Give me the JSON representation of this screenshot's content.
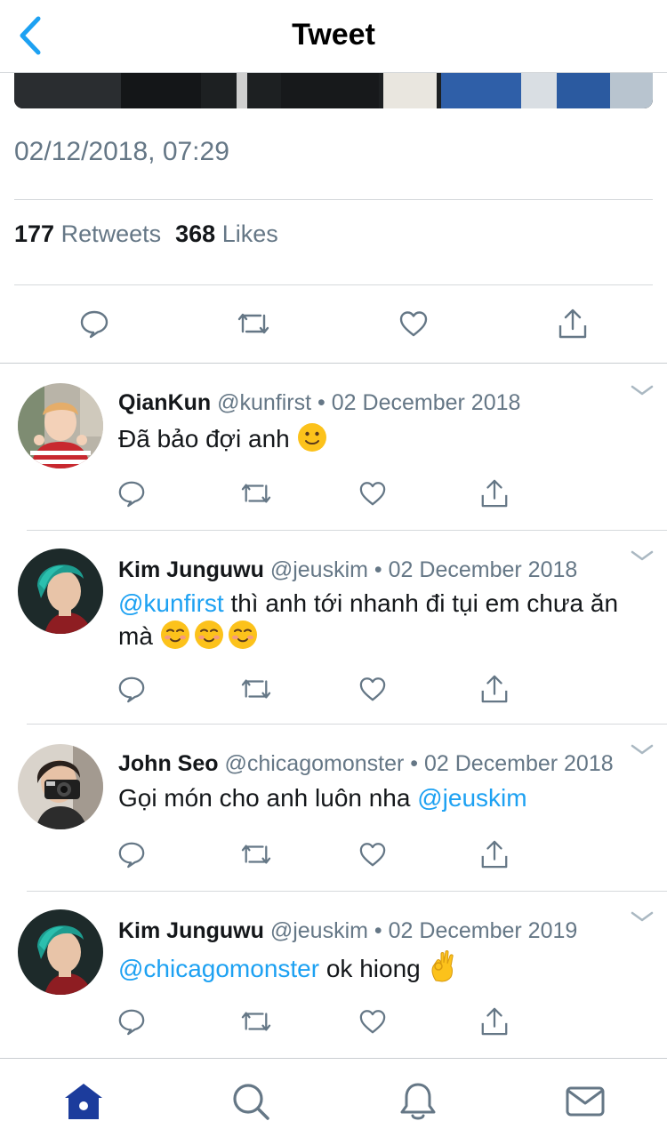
{
  "nav": {
    "title": "Tweet",
    "back_icon": "chevron-left-icon"
  },
  "tweet": {
    "timestamp": "02/12/2018, 07:29",
    "retweets_count": "177",
    "retweets_label": "Retweets",
    "likes_count": "368",
    "likes_label": "Likes"
  },
  "replies": [
    {
      "name": "QianKun",
      "handle": "@kunfirst",
      "date": "02 December 2018",
      "mention": "",
      "text": "Đã bảo đợi anh",
      "emoji": "slightly-smiling-face",
      "emoji_count": 1
    },
    {
      "name": "Kim Junguwu",
      "handle": "@jeuskim",
      "date": "02 December 2018",
      "mention": "@kunfirst",
      "text": "thì anh tới nhanh đi tụi em chưa ăn mà",
      "emoji": "smiling-face",
      "emoji_count": 3
    },
    {
      "name": "John Seo",
      "handle": "@chicagomonster",
      "date": "02 December 2018",
      "text": "Gọi món cho anh luôn nha",
      "trailing_mention": "@jeuskim"
    },
    {
      "name": "Kim Junguwu",
      "handle": "@jeuskim",
      "date": "02 December 2019",
      "mention": "@chicagomonster",
      "text": "ok hiong",
      "emoji": "ok-hand",
      "emoji_count": 1
    }
  ],
  "colors": {
    "accent": "#1da1f2",
    "muted": "#657786",
    "text": "#14171a",
    "divider": "#d6d9dc",
    "tab_active": "#1c3c9c"
  },
  "tabbar": {
    "items": [
      "home-icon",
      "search-icon",
      "notifications-bell-icon",
      "messages-envelope-icon"
    ],
    "active": "home-icon"
  }
}
